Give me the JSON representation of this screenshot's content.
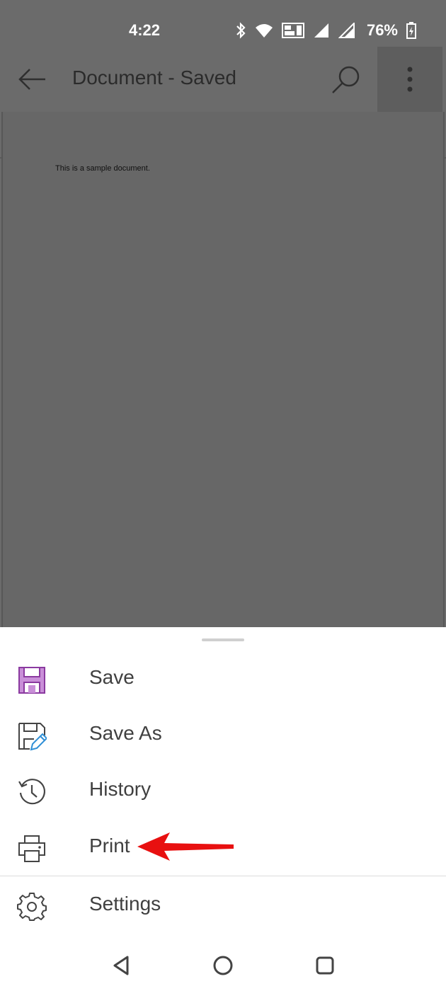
{
  "status_bar": {
    "time": "4:22",
    "battery": "76%",
    "icons": [
      "bluetooth-icon",
      "wifi-icon",
      "volte-icon",
      "signal-icon",
      "signal-icon",
      "battery-icon"
    ]
  },
  "app_bar": {
    "title": "Document - Saved",
    "back_icon": "back-arrow-icon",
    "search_icon": "search-icon",
    "more_icon": "more-vertical-icon"
  },
  "document": {
    "text": "This is a sample document."
  },
  "menu": {
    "items": [
      {
        "label": "Save",
        "icon": "save-icon"
      },
      {
        "label": "Save As",
        "icon": "save-as-icon"
      },
      {
        "label": "History",
        "icon": "history-icon"
      },
      {
        "label": "Print",
        "icon": "print-icon"
      },
      {
        "label": "Settings",
        "icon": "gear-icon"
      }
    ]
  },
  "annotation": {
    "icon": "red-arrow-icon",
    "color": "#e81010"
  },
  "nav_bar": {
    "buttons": [
      "back-triangle-icon",
      "home-circle-icon",
      "recents-square-icon"
    ]
  },
  "colors": {
    "dim_overlay": "#6b6b6b",
    "save_icon": "#b34fc7",
    "save_as_pencil": "#2f8fd6"
  }
}
